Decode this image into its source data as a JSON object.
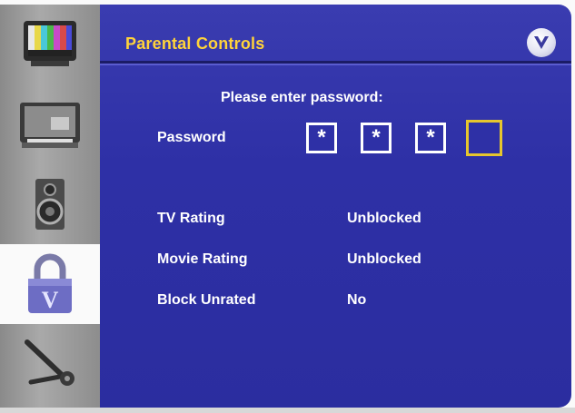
{
  "header": {
    "title": "Parental Controls",
    "brand_icon": "vizio-v-logo"
  },
  "sidebar": {
    "items": [
      {
        "name": "picture",
        "icon": "color-bars-tv-icon",
        "active": false
      },
      {
        "name": "tv-input",
        "icon": "tv-monitor-icon",
        "active": false
      },
      {
        "name": "audio",
        "icon": "speaker-icon",
        "active": false
      },
      {
        "name": "parental",
        "icon": "padlock-v-icon",
        "active": true
      },
      {
        "name": "setup",
        "icon": "wrench-icon",
        "active": false
      }
    ]
  },
  "password": {
    "prompt": "Please enter password:",
    "label": "Password",
    "digits": [
      "*",
      "*",
      "*",
      ""
    ]
  },
  "settings": [
    {
      "label": "TV Rating",
      "value": "Unblocked"
    },
    {
      "label": "Movie Rating",
      "value": "Unblocked"
    },
    {
      "label": "Block Unrated",
      "value": "No"
    }
  ],
  "colors": {
    "panel": "#2e30a6",
    "title": "#ffd33a",
    "focus": "#e6c62e",
    "text": "#ffffff"
  }
}
